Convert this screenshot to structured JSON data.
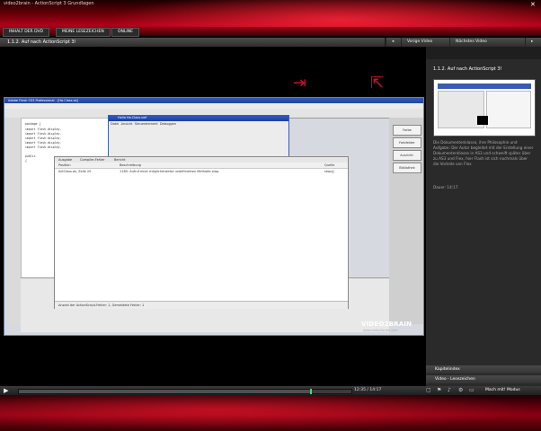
{
  "window": {
    "title": "video2brain - ActionScript 3 Grundlagen",
    "close": "✕"
  },
  "nav": {
    "tabs": [
      "INHALT DER DVD",
      "MEINE LESEZEICHEN",
      "ONLINE"
    ]
  },
  "toolbar": {
    "chapter": "1.1.2. Auf nach ActionScript 3!",
    "prev_label": "Vorige Video",
    "next_label": "Nächstes Video"
  },
  "ide": {
    "title": "Adobe Flash CS3 Professional - [Ha.Class.as]",
    "code": [
      "package {",
      "  import flash.display.",
      "  import flash.display.",
      "  import flash.display.",
      "  import flash.display.",
      "  import flash.display.",
      "",
      "  public",
      "  {",
      "    ..."
    ],
    "right_panel": [
      "Farbe",
      "Farbfelder",
      "Ausricht.",
      "Bibliothek"
    ],
    "panel_tabs": [
      "Ausgabe",
      "Compiler-Fehler",
      "Bericht"
    ],
    "panel_cols": [
      "Position",
      "Beschreibung",
      "Quelle"
    ],
    "panel_row": [
      "ActClass.as, Zeile 20",
      "1180: Aufruf einer möglicherweise undefinierten Methode stop.",
      "stop();"
    ],
    "panel_footer": "Anzahl der ActionScript-Fehler: 1, Gemeldete Fehler: 1",
    "dialog_title": "Hallo Ha.Class.swf",
    "dialog_menu": [
      "Datei",
      "Ansicht",
      "Steuerelement",
      "Debuggen"
    ]
  },
  "watermark": {
    "brand": "VIDEO2BRAIN",
    "sub": "www.video2brain.com"
  },
  "sidebar": {
    "title": "1.1.2. Auf nach ActionScript 3!",
    "description": "Die Dokumentenklasse, ihre Philosophie und Aufgabe: Der Autor begleitet mit der Erstellung einer Dokumentenklasse in AS3 und schweift später über zu AS3 und Flex, hier Flash ist sich nochmals über die Vorteile von Flex",
    "duration": "Dauer: 14:17",
    "sections": [
      "Kapitelindex",
      "Video - Lesezeichen"
    ]
  },
  "controls": {
    "timecode": "12:35 / 14:17",
    "quality": "Mach mit! Modus",
    "progress": 0.88
  }
}
